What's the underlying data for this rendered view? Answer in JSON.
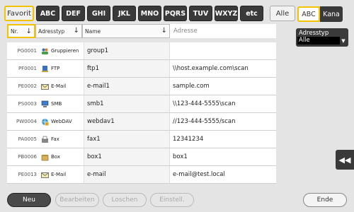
{
  "tabs": {
    "favorit": "Favorit",
    "letters": [
      "ABC",
      "DEF",
      "GHI",
      "JKL",
      "MNO",
      "PQRS",
      "TUV",
      "WXYZ",
      "etc"
    ],
    "alle": "Alle"
  },
  "script_toggle": {
    "abc": "ABC",
    "kana": "Kana"
  },
  "columns": {
    "nr": "Nr.",
    "adresstyp": "Adresstyp",
    "name": "Name",
    "adresse": "Adresse"
  },
  "rows": [
    {
      "nr": "PG0001",
      "type": "Gruppieren",
      "icon": "group-icon",
      "name": "group1",
      "address": ""
    },
    {
      "nr": "PF0001",
      "type": "FTP",
      "icon": "ftp-icon",
      "name": "ftp1",
      "address": "\\\\host.example.com\\scan"
    },
    {
      "nr": "PE0002",
      "type": "E-Mail",
      "icon": "email-icon",
      "name": "e-mail1",
      "address": "sample.com"
    },
    {
      "nr": "PS0003",
      "type": "SMB",
      "icon": "smb-icon",
      "name": "smb1",
      "address": "\\\\123-444-5555\\scan"
    },
    {
      "nr": "PW0004",
      "type": "WebDAV",
      "icon": "webdav-icon",
      "name": "webdav1",
      "address": "//123-444-5555/scan"
    },
    {
      "nr": "PA0005",
      "type": "Fax",
      "icon": "fax-icon",
      "name": "fax1",
      "address": "12341234"
    },
    {
      "nr": "PB0006",
      "type": "Box",
      "icon": "box-icon",
      "name": "box1",
      "address": "box1"
    },
    {
      "nr": "PE0013",
      "type": "E-Mail",
      "icon": "email-icon",
      "name": "e-mail",
      "address": "e-mail@test.local"
    }
  ],
  "address_type_filter": {
    "label": "Adresstyp",
    "value": "Alle"
  },
  "buttons": {
    "neu": "Neu",
    "bearbeiten": "Bearbeiten",
    "loschen": "Loschen",
    "einstell": "Einstell.",
    "ende": "Ende"
  },
  "colors": {
    "accent": "#f2c300",
    "dark": "#3a3a3a"
  }
}
